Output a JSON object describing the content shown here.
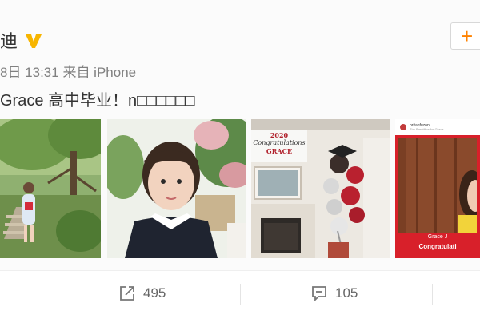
{
  "post": {
    "author_name": "迪",
    "verified": true,
    "meta": "8日 13:31 来自 iPhone",
    "text": "Grace 高中毕业！n□□□□□□",
    "follow_label": "+"
  },
  "photos": [
    {
      "name": "garden-photo"
    },
    {
      "name": "portrait-photo"
    },
    {
      "name": "graduation-room-photo",
      "banner_year": "2020",
      "banner_text": "Congratulations",
      "banner_name": "GRACE"
    },
    {
      "name": "instagram-post-photo",
      "header_name": "britanfuzon",
      "header_sub": "The Brentiline for Grace",
      "caption_name": "Grace J",
      "caption_text": "Congratulati"
    }
  ],
  "actions": {
    "share_count": "495",
    "comment_count": "105"
  },
  "colors": {
    "accent": "#ff8200",
    "verified": "#f7b500",
    "frame_red": "#d8202a"
  }
}
